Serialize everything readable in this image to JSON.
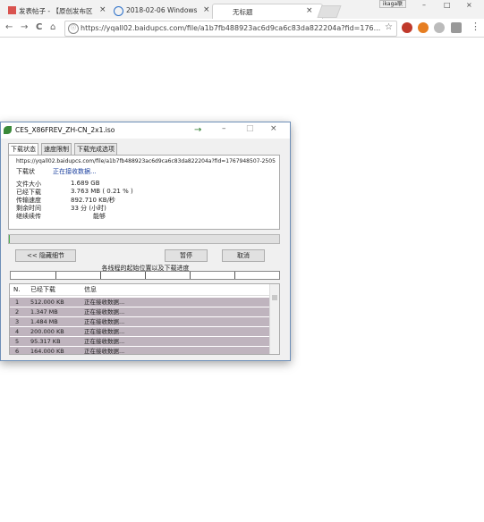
{
  "browser": {
    "tabs": [
      {
        "label": "发表帖子 - 【原创发布区",
        "close": "×"
      },
      {
        "label": "2018-02-06 Windows",
        "close": "×"
      },
      {
        "label": "无标题",
        "close": "×"
      }
    ],
    "profile": "ikaga联",
    "window_controls": {
      "minimize": "–",
      "maximize": "□",
      "close": "×"
    },
    "nav": {
      "back": "←",
      "forward": "→",
      "reload": "C",
      "home": "⌂"
    },
    "url": "https://yqall02.baidupcs.com/file/a1b7fb488923ac6d9ca6c83da822204a?fid=176...",
    "lock": "ⓘ",
    "star": "☆",
    "extension_icons": [
      "abp-icon",
      "circle-icon",
      "cloud-icon",
      "tablet-icon",
      "menu-icon"
    ]
  },
  "idm": {
    "title": "CES_X86FREV_ZH-CN_2x1.iso",
    "title_arrow": "→",
    "window_buttons": {
      "min": "–",
      "max": "□",
      "close": "×"
    },
    "tabs": [
      "下载状态",
      "速度限制",
      "下载完成选项"
    ],
    "url": "https://yqall02.baidupcs.com/file/a1b7fb488923ac6d9ca6c83da822204a?fid=1767948507-25052t",
    "status_label": "下载状",
    "status_value": "正在接收数据...",
    "fields": [
      {
        "label": "文件大小",
        "value": "1.689 GB"
      },
      {
        "label": "已经下载",
        "value": "3.763 MB ( 0.21 % )"
      },
      {
        "label": "传输速度",
        "value": "892.710 KB/秒"
      },
      {
        "label": "剩余时间",
        "value": "33 分 (小时)"
      },
      {
        "label": "继续续传",
        "value": "能够"
      }
    ],
    "progress": 0.0021,
    "buttons": {
      "details": "<< 隐藏细节",
      "pause": "暂停",
      "cancel": "取消"
    },
    "segment_label": "各线程的起始位置以及下载进度",
    "list_headers": [
      "N.",
      "已经下载",
      "信息"
    ],
    "rows": [
      {
        "n": "1",
        "downloaded": "512.000 KB",
        "info": "正在接收数据..."
      },
      {
        "n": "2",
        "downloaded": "1.347 MB",
        "info": "正在接收数据..."
      },
      {
        "n": "3",
        "downloaded": "1.484 MB",
        "info": "正在接收数据..."
      },
      {
        "n": "4",
        "downloaded": "200.000 KB",
        "info": "正在接收数据..."
      },
      {
        "n": "5",
        "downloaded": "95.317 KB",
        "info": "正在接收数据..."
      },
      {
        "n": "6",
        "downloaded": "164.000 KB",
        "info": "正在接收数据..."
      }
    ]
  }
}
